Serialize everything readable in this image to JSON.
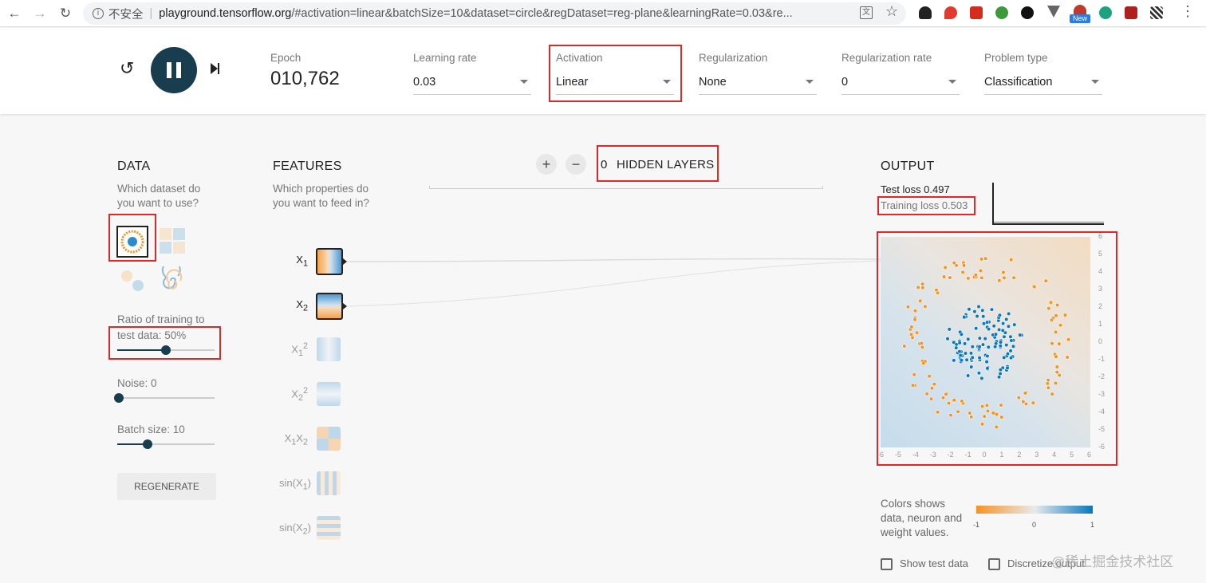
{
  "browser": {
    "security": "不安全",
    "url_domain": "playground.tensorflow.org",
    "url_rest": "/#activation=linear&batchSize=10&dataset=circle&regDataset=reg-plane&learningRate=0.03&re...",
    "new_badge": "New"
  },
  "controls": {
    "epoch_label": "Epoch",
    "epoch_value": "010,762",
    "learning_rate_label": "Learning rate",
    "learning_rate_value": "0.03",
    "activation_label": "Activation",
    "activation_value": "Linear",
    "regularization_label": "Regularization",
    "regularization_value": "None",
    "reg_rate_label": "Regularization rate",
    "reg_rate_value": "0",
    "problem_type_label": "Problem type",
    "problem_type_value": "Classification"
  },
  "data_panel": {
    "title": "DATA",
    "question_1": "Which dataset do",
    "question_2": "you want to use?",
    "ratio_label_1": "Ratio of training to",
    "ratio_label_2": "test data:  50%",
    "ratio_value": 0.5,
    "noise_label": "Noise:  0",
    "noise_value": 0,
    "batch_label": "Batch size:  10",
    "batch_value": 0.3,
    "regenerate": "REGENERATE",
    "datasets": [
      "circle",
      "xor",
      "gaussian",
      "spiral"
    ],
    "selected_dataset": "circle"
  },
  "features": {
    "title": "FEATURES",
    "question_1": "Which properties do",
    "question_2": "you want to feed in?",
    "items": [
      {
        "label": "X₁",
        "active": true
      },
      {
        "label": "X₂",
        "active": true
      },
      {
        "label": "X₁²",
        "active": false
      },
      {
        "label": "X₂²",
        "active": false
      },
      {
        "label": "X₁X₂",
        "active": false
      },
      {
        "label": "sin(X₁)",
        "active": false
      },
      {
        "label": "sin(X₂)",
        "active": false
      }
    ]
  },
  "network": {
    "add_layer": "+",
    "remove_layer": "−",
    "hidden_layer_count": "0",
    "hidden_layers_label": "HIDDEN LAYERS"
  },
  "output": {
    "title": "OUTPUT",
    "test_loss": "Test loss 0.497",
    "training_loss": "Training loss 0.503",
    "x_ticks": [
      "-6",
      "-5",
      "-4",
      "-3",
      "-2",
      "-1",
      "0",
      "1",
      "2",
      "3",
      "4",
      "5",
      "6"
    ],
    "y_ticks": [
      "6",
      "5",
      "4",
      "3",
      "2",
      "1",
      "0",
      "-1",
      "-2",
      "-3",
      "-4",
      "-5",
      "-6"
    ],
    "colors_note_1": "Colors shows",
    "colors_note_2": "data, neuron and",
    "colors_note_3": "weight values.",
    "legend_min": "-1",
    "legend_mid": "0",
    "legend_max": "1",
    "show_test_data": "Show test data",
    "discretize_output": "Discretize output",
    "color_negative": "#f59322",
    "color_positive": "#0877bd"
  },
  "watermark": "@稀土掘金技术社区"
}
